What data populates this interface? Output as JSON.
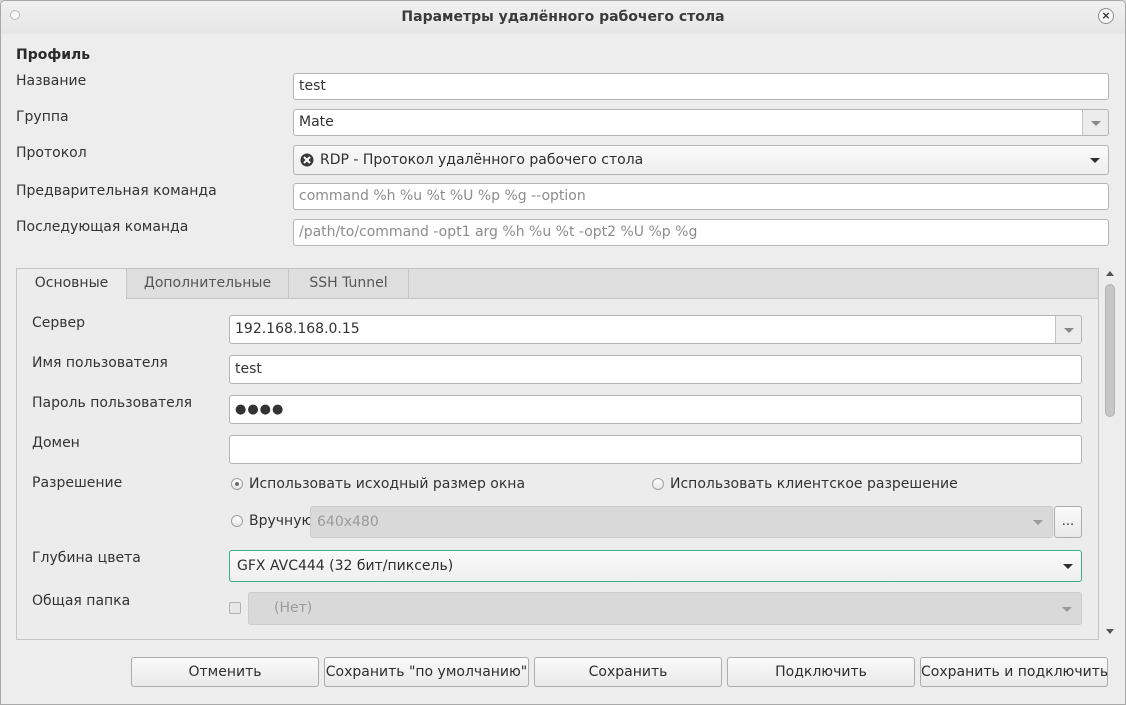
{
  "window": {
    "title": "Параметры удалённого рабочего стола",
    "close_glyph": "×"
  },
  "profile": {
    "section_title": "Профиль",
    "name_label": "Название",
    "name_value": "test",
    "group_label": "Группа",
    "group_value": "Mate",
    "protocol_label": "Протокол",
    "protocol_value": "RDP - Протокол удалённого рабочего стола",
    "precommand_label": "Предварительная команда",
    "precommand_placeholder": "command %h %u %t %U %p %g --option",
    "postcommand_label": "Последующая команда",
    "postcommand_placeholder": "/path/to/command -opt1 arg %h %u %t -opt2 %U %p %g"
  },
  "tabs": [
    {
      "label": "Основные",
      "active": true
    },
    {
      "label": "Дополнительные",
      "active": false
    },
    {
      "label": "SSH Tunnel",
      "active": false
    }
  ],
  "basic": {
    "server_label": "Сервер",
    "server_value": "192.168.168.0.15",
    "username_label": "Имя пользователя",
    "username_value": "test",
    "password_label": "Пароль пользователя",
    "password_dots": "●●●●",
    "domain_label": "Домен",
    "domain_value": "",
    "resolution_label": "Разрешение",
    "res_option_window": "Использовать исходный размер окна",
    "res_option_client": "Использовать клиентское разрешение",
    "res_option_manual": "Вручную",
    "res_manual_value": "640x480",
    "res_more_button": "...",
    "color_depth_label": "Глубина цвета",
    "color_depth_value": "GFX AVC444 (32 бит/пиксель)",
    "shared_folder_label": "Общая папка",
    "shared_folder_value": "(Нет)"
  },
  "buttons": {
    "cancel": "Отменить",
    "save_default": "Сохранить \"по умолчанию\"",
    "save": "Сохранить",
    "connect": "Подключить",
    "save_connect": "Сохранить и подключить"
  }
}
